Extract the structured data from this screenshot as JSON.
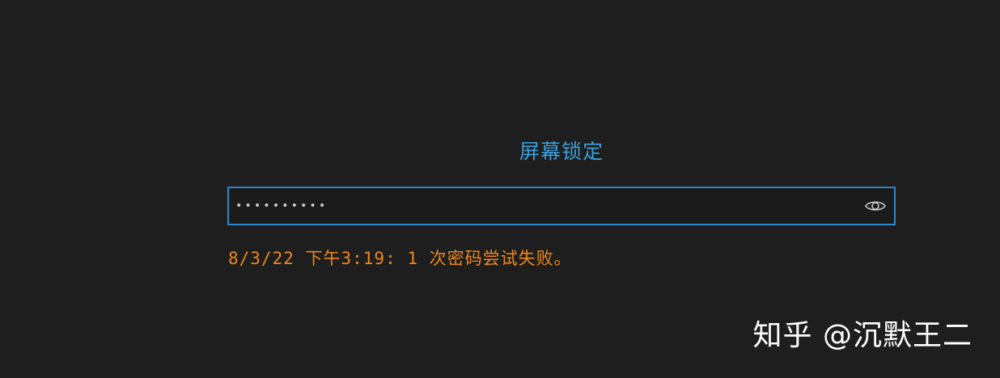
{
  "lock_screen": {
    "title": "屏幕锁定",
    "password": {
      "masked_value": "••••••••••",
      "toggle_icon": "eye-icon"
    },
    "error_message": "8/3/22 下午3:19: 1 次密码尝试失败。"
  },
  "watermark": {
    "text": "知乎 @沉默王二"
  },
  "colors": {
    "background": "#1e1e1e",
    "title": "#3a9fdc",
    "input_border": "#2f86c9",
    "error": "#f0871c",
    "watermark": "#ffffff"
  }
}
